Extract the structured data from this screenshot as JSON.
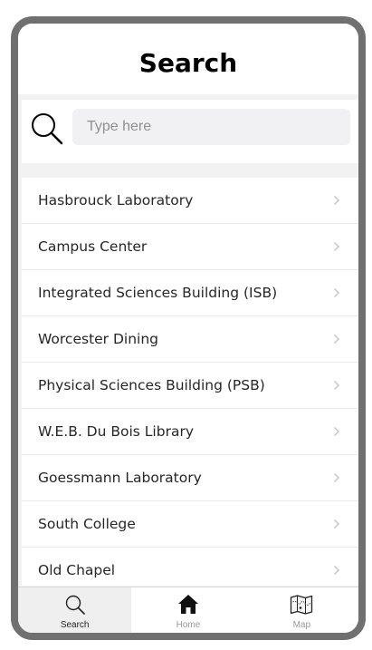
{
  "header": {
    "title": "Search"
  },
  "search": {
    "placeholder": "Type here",
    "value": ""
  },
  "locations": [
    {
      "label": "Hasbrouck Laboratory"
    },
    {
      "label": "Campus Center"
    },
    {
      "label": "Integrated Sciences Building (ISB)"
    },
    {
      "label": "Worcester Dining"
    },
    {
      "label": "Physical Sciences Building (PSB)"
    },
    {
      "label": "W.E.B. Du Bois Library"
    },
    {
      "label": "Goessmann Laboratory"
    },
    {
      "label": "South College"
    },
    {
      "label": "Old Chapel"
    }
  ],
  "tabs": [
    {
      "label": "Search",
      "icon": "search-icon",
      "active": true
    },
    {
      "label": "Home",
      "icon": "home-icon",
      "active": false
    },
    {
      "label": "Map",
      "icon": "map-icon",
      "active": false
    }
  ],
  "colors": {
    "frame": "#707070",
    "active_tab_bg": "#efefef",
    "search_field_bg": "#f1f1f3",
    "placeholder": "#8e8e93"
  }
}
